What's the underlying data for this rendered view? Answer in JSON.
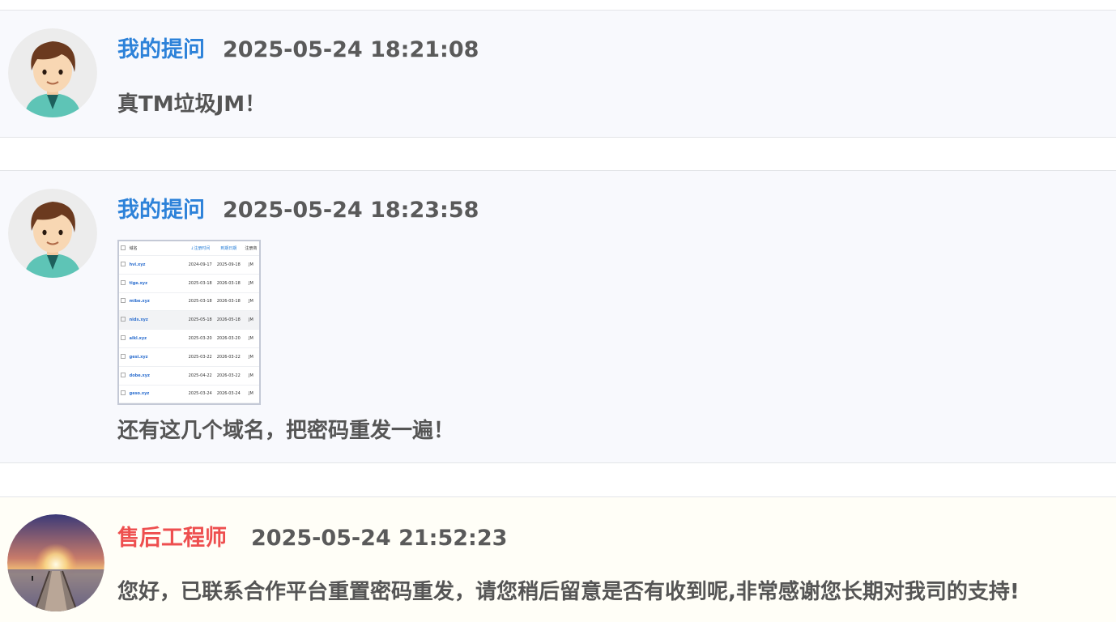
{
  "messages": [
    {
      "author": "我的提问",
      "timestamp": "2025-05-24 18:21:08",
      "text": "真TM垃圾JM！"
    },
    {
      "author": "我的提问",
      "timestamp": "2025-05-24 18:23:58",
      "text": "还有这几个域名，把密码重发一遍！",
      "attachment": {
        "headers": [
          "域名",
          "↓注册时间",
          "到期日期",
          "注册商"
        ],
        "rows": [
          {
            "domain": "hvi.xyz",
            "registered": "2024-09-17",
            "expires": "2025-09-18",
            "registrar": "JM"
          },
          {
            "domain": "tige.xyz",
            "registered": "2025-03-18",
            "expires": "2026-03-18",
            "registrar": "JM"
          },
          {
            "domain": "mibe.xyz",
            "registered": "2025-03-18",
            "expires": "2026-03-18",
            "registrar": "JM"
          },
          {
            "domain": "nids.xyz",
            "registered": "2025-05-18",
            "expires": "2026-05-18",
            "registrar": "JM"
          },
          {
            "domain": "aikl.xyz",
            "registered": "2025-03-20",
            "expires": "2026-03-20",
            "registrar": "JM"
          },
          {
            "domain": "gesi.xyz",
            "registered": "2025-03-22",
            "expires": "2026-03-22",
            "registrar": "JM"
          },
          {
            "domain": "dobe.xyz",
            "registered": "2025-04-22",
            "expires": "2026-03-22",
            "registrar": "JM"
          },
          {
            "domain": "geso.xyz",
            "registered": "2025-03-24",
            "expires": "2026-03-24",
            "registrar": "JM"
          }
        ]
      }
    },
    {
      "author": "售后工程师",
      "timestamp": "2025-05-24 21:52:23",
      "text": "您好，已联系合作平台重置密码重发，请您稍后留意是否有收到呢,非常感谢您长期对我司的支持!"
    }
  ],
  "colors": {
    "user_author": "#2d82d9",
    "staff_author": "#ee4f4f",
    "user_bg": "#f8f9fd",
    "staff_bg": "#fffef7"
  },
  "icons": {
    "user_avatar": "cartoon-boy-avatar-icon",
    "staff_avatar": "sunset-pier-avatar-icon"
  }
}
